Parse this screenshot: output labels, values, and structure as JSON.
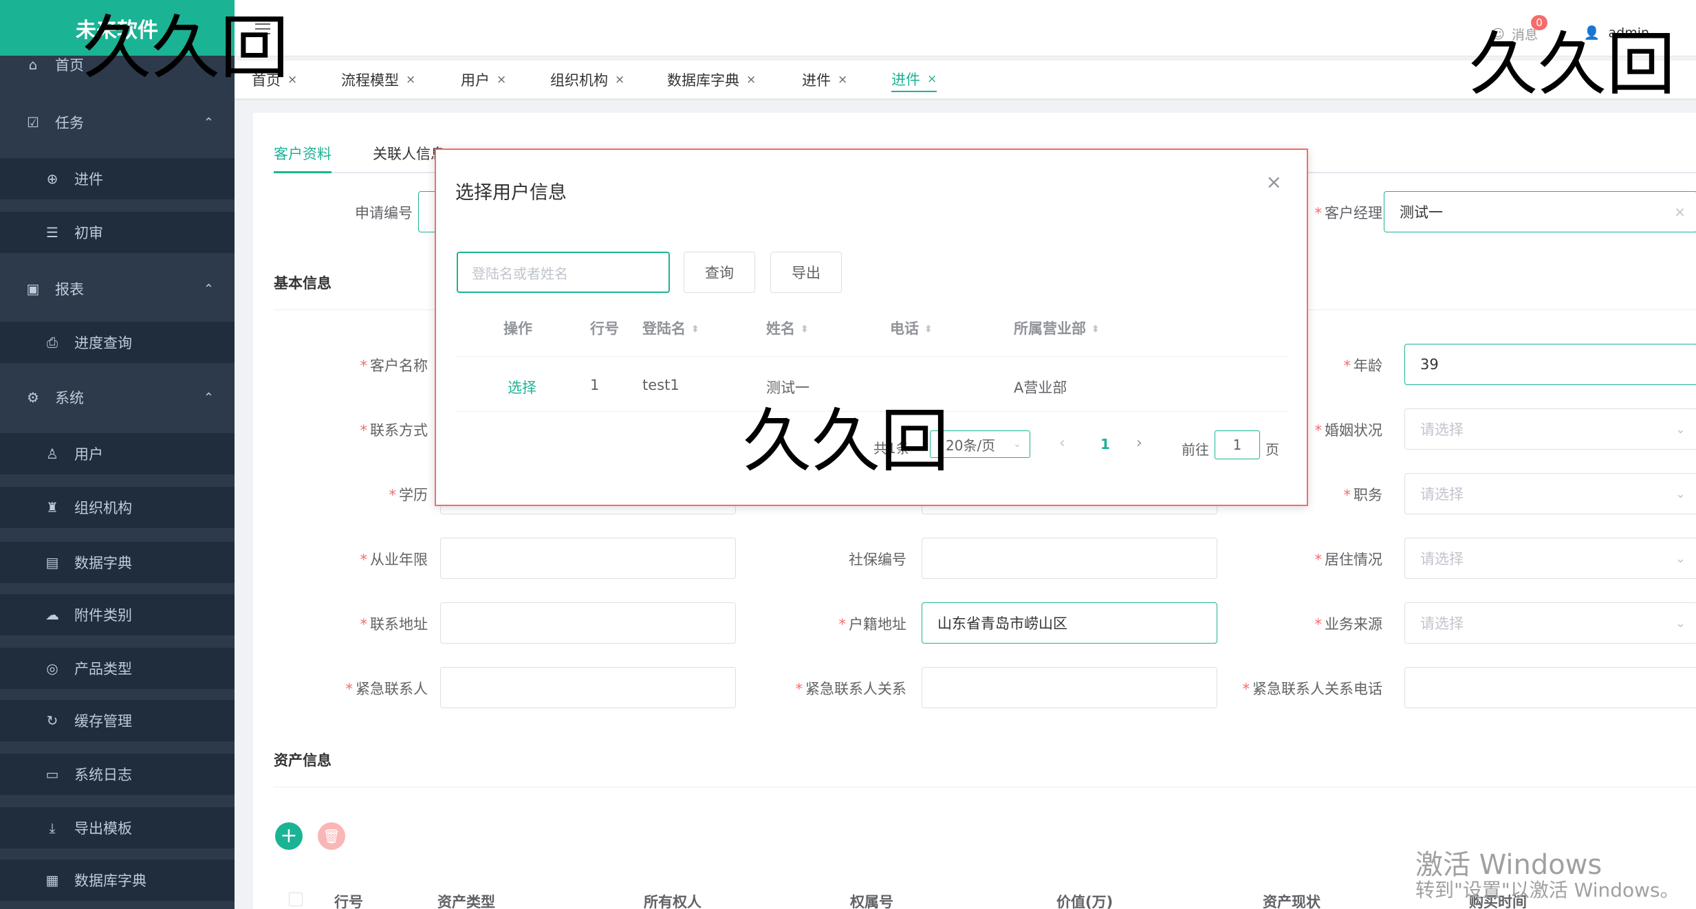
{
  "sidebar": {
    "logo": "未来软件",
    "items": [
      {
        "label": "首页",
        "icon": "home-icon",
        "type": "top"
      },
      {
        "label": "任务",
        "icon": "task-icon",
        "type": "top",
        "arrow": "⌃"
      },
      {
        "label": "进件",
        "icon": "plus-circle-icon",
        "type": "sub"
      },
      {
        "label": "初审",
        "icon": "list-icon",
        "type": "sub"
      },
      {
        "label": "报表",
        "icon": "chart-icon",
        "type": "top",
        "arrow": "⌃"
      },
      {
        "label": "进度查询",
        "icon": "search-doc-icon",
        "type": "sub"
      },
      {
        "label": "系统",
        "icon": "gear-icon",
        "type": "top",
        "arrow": "⌃"
      },
      {
        "label": "用户",
        "icon": "user-icon",
        "type": "sub"
      },
      {
        "label": "组织机构",
        "icon": "org-icon",
        "type": "sub"
      },
      {
        "label": "数据字典",
        "icon": "dictionary-icon",
        "type": "sub"
      },
      {
        "label": "附件类别",
        "icon": "cloud-upload-icon",
        "type": "sub"
      },
      {
        "label": "产品类型",
        "icon": "product-icon",
        "type": "sub"
      },
      {
        "label": "缓存管理",
        "icon": "refresh-icon",
        "type": "sub"
      },
      {
        "label": "系统日志",
        "icon": "log-icon",
        "type": "sub"
      },
      {
        "label": "导出模板",
        "icon": "download-icon",
        "type": "sub"
      },
      {
        "label": "数据库字典",
        "icon": "database-icon",
        "type": "sub"
      }
    ]
  },
  "header": {
    "msg_label": "消息",
    "msg_count": "0",
    "user": "admin"
  },
  "tags": [
    {
      "label": "首页"
    },
    {
      "label": "流程模型"
    },
    {
      "label": "用户"
    },
    {
      "label": "组织机构"
    },
    {
      "label": "数据库字典"
    },
    {
      "label": "进件"
    },
    {
      "label": "进件",
      "active": true
    }
  ],
  "form": {
    "tabs": [
      "客户资料",
      "关联人信息"
    ],
    "apply_no_label": "申请编号",
    "manager_label": "客户经理",
    "manager_value": "测试一",
    "section_basic": "基本信息",
    "section_assets": "资产信息",
    "fields": {
      "customer_name": "客户名称",
      "age": "年龄",
      "age_value": "39",
      "contact": "联系方式",
      "marital": "婚姻状况",
      "education": "学历",
      "position": "职务",
      "years": "从业年限",
      "social_no": "社保编号",
      "residence": "居住情况",
      "address": "联系地址",
      "household": "户籍地址",
      "household_value": "山东省青岛市崂山区",
      "source": "业务来源",
      "emergency": "紧急联系人",
      "emergency_rel": "紧急联系人关系",
      "emergency_phone": "紧急联系人关系电话",
      "placeholder_select": "请选择"
    },
    "asset_headers": [
      "行号",
      "资产类型",
      "所有权人",
      "权属号",
      "价值(万)",
      "资产现状",
      "购买时间"
    ]
  },
  "modal": {
    "title": "选择用户信息",
    "search_placeholder": "登陆名或者姓名",
    "query_button": "查询",
    "export_button": "导出",
    "headers": [
      "操作",
      "行号",
      "登陆名",
      "姓名",
      "电话",
      "所属营业部"
    ],
    "row": {
      "action": "选择",
      "no": "1",
      "login": "test1",
      "name": "测试一",
      "phone": "",
      "dept": "A营业部"
    },
    "pager": {
      "total": "共1条",
      "size": "20条/页",
      "current": "1",
      "goto": "前往",
      "goto_value": "1",
      "page_unit": "页"
    }
  },
  "watermarks": {
    "text": "久久回",
    "windows_line1": "激活 Windows",
    "windows_line2": "转到\"设置\"以激活 Windows。"
  }
}
